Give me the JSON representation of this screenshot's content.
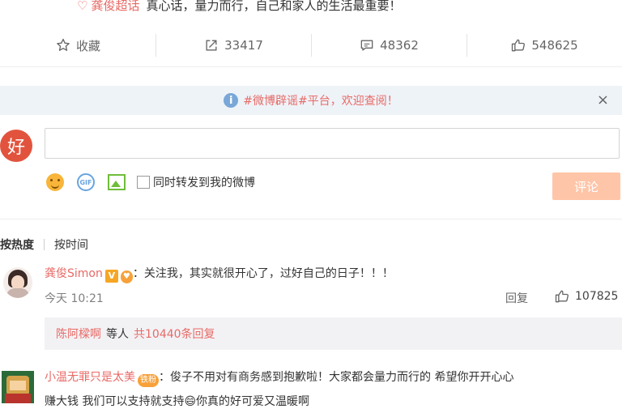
{
  "post": {
    "tag": "龚俊超话",
    "text": "真心话，量力而行，自己和家人的生活最重要！"
  },
  "actions": {
    "favorite": "收藏",
    "repost": "33417",
    "comment": "48362",
    "like": "548625"
  },
  "notice": {
    "text": "#微博辟谣#平台，欢迎查阅！",
    "close": "×"
  },
  "composer": {
    "avatar_text": "好",
    "input_value": "",
    "sync_label": "同时转发到我的微博",
    "submit_label": "评论"
  },
  "sort": {
    "hot": "按热度",
    "time": "按时间"
  },
  "comments": [
    {
      "user": "龚俊Simon",
      "badge": "V",
      "text": "：关注我，其实就很开心了，过好自己的日子！！！",
      "time": "今天 10:21",
      "reply_label": "回复",
      "likes": "107825",
      "subreply": {
        "name": "陈阿樑啊",
        "middle": "等人",
        "count": "共10440条回复"
      }
    },
    {
      "user": "小温无罪只是太美",
      "badge": "铁粉",
      "text_line1": "：俊子不用对有商务感到抱歉啦！大家都会量力而行的 希望你开开心心",
      "text_line2": "赚大钱 我们可以支持就支持😄你真的好可爱又温暖啊"
    }
  ],
  "colors": {
    "accent": "#e86a66",
    "submit_disabled": "#ffc5a8",
    "notice_bg": "#eef3f8"
  }
}
